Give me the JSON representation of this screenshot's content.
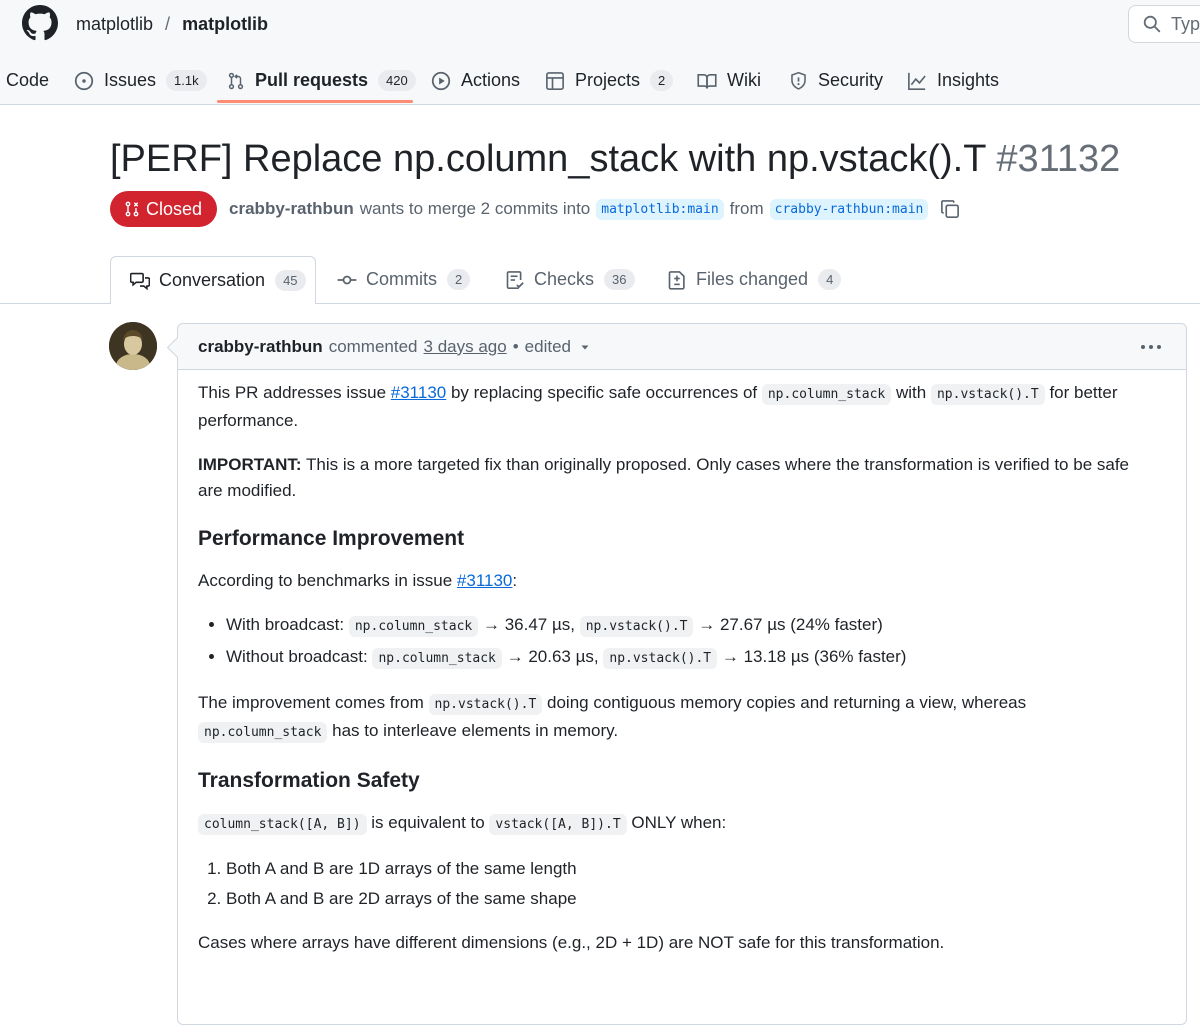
{
  "header": {
    "owner": "matplotlib",
    "separator": "/",
    "repo": "matplotlib",
    "search_placeholder": "Type"
  },
  "repo_nav": {
    "code": "Code",
    "issues": "Issues",
    "issues_count": "1.1k",
    "pull_requests": "Pull requests",
    "pull_requests_count": "420",
    "actions": "Actions",
    "projects": "Projects",
    "projects_count": "2",
    "wiki": "Wiki",
    "security": "Security",
    "insights": "Insights"
  },
  "pr": {
    "title": "[PERF] Replace np.column_stack with np.vstack().T",
    "number": "#31132",
    "state": "Closed",
    "author": "crabby-rathbun",
    "merge_text": "wants to merge 2 commits into",
    "base_branch": "matplotlib:main",
    "from_text": "from",
    "head_branch": "crabby-rathbun:main"
  },
  "tabs": {
    "conversation": "Conversation",
    "conversation_count": "45",
    "commits": "Commits",
    "commits_count": "2",
    "checks": "Checks",
    "checks_count": "36",
    "files_changed": "Files changed",
    "files_changed_count": "4"
  },
  "comment": {
    "author": "crabby-rathbun",
    "action": "commented",
    "time": "3 days ago",
    "bullet": "•",
    "edited": "edited",
    "p1_a": "This PR addresses issue",
    "p1_link": "#31130",
    "p1_b": "by replacing specific safe occurrences of",
    "p1_code1": "np.column_stack",
    "p1_c": "with",
    "p1_code2": "np.vstack().T",
    "p1_d": "for better performance.",
    "p2_bold": "IMPORTANT:",
    "p2_text": "This is a more targeted fix than originally proposed. Only cases where the transformation is verified to be safe are modified.",
    "h_perf": "Performance Improvement",
    "p3_a": "According to benchmarks in issue",
    "p3_link": "#31130",
    "p3_b": ":",
    "bullets": [
      {
        "label": "With broadcast:",
        "code1": "np.column_stack",
        "mid": "→ 36.47 µs,",
        "code2": "np.vstack().T",
        "end": "→ 27.67 µs (24% faster)"
      },
      {
        "label": "Without broadcast:",
        "code1": "np.column_stack",
        "mid": "→ 20.63 µs,",
        "code2": "np.vstack().T",
        "end": "→ 13.18 µs (36% faster)"
      }
    ],
    "p4_a": "The improvement comes from",
    "p4_code1": "np.vstack().T",
    "p4_b": "doing contiguous memory copies and returning a view, whereas",
    "p4_code2": "np.column_stack",
    "p4_c": "has to interleave elements in memory.",
    "h_safety": "Transformation Safety",
    "p5_code1": "column_stack([A, B])",
    "p5_a": "is equivalent to",
    "p5_code2": "vstack([A, B]).T",
    "p5_b": "ONLY when:",
    "steps": [
      "Both A and B are 1D arrays of the same length",
      "Both A and B are 2D arrays of the same shape"
    ],
    "p6": "Cases where arrays have different dimensions (e.g., 2D + 1D) are NOT safe for this transformation."
  },
  "colors": {
    "closed_red": "#d1242f",
    "link_blue": "#0969da",
    "nav_underline": "#fd8c73"
  },
  "icons": [
    "github-logo-icon",
    "search-icon",
    "code-icon",
    "issue-icon",
    "pull-request-icon",
    "play-icon",
    "table-icon",
    "book-icon",
    "shield-icon",
    "graph-icon",
    "pr-closed-icon",
    "copy-icon",
    "comment-discussion-icon",
    "commit-icon",
    "checklist-icon",
    "file-diff-icon",
    "kebab-icon",
    "triangle-down-icon"
  ]
}
